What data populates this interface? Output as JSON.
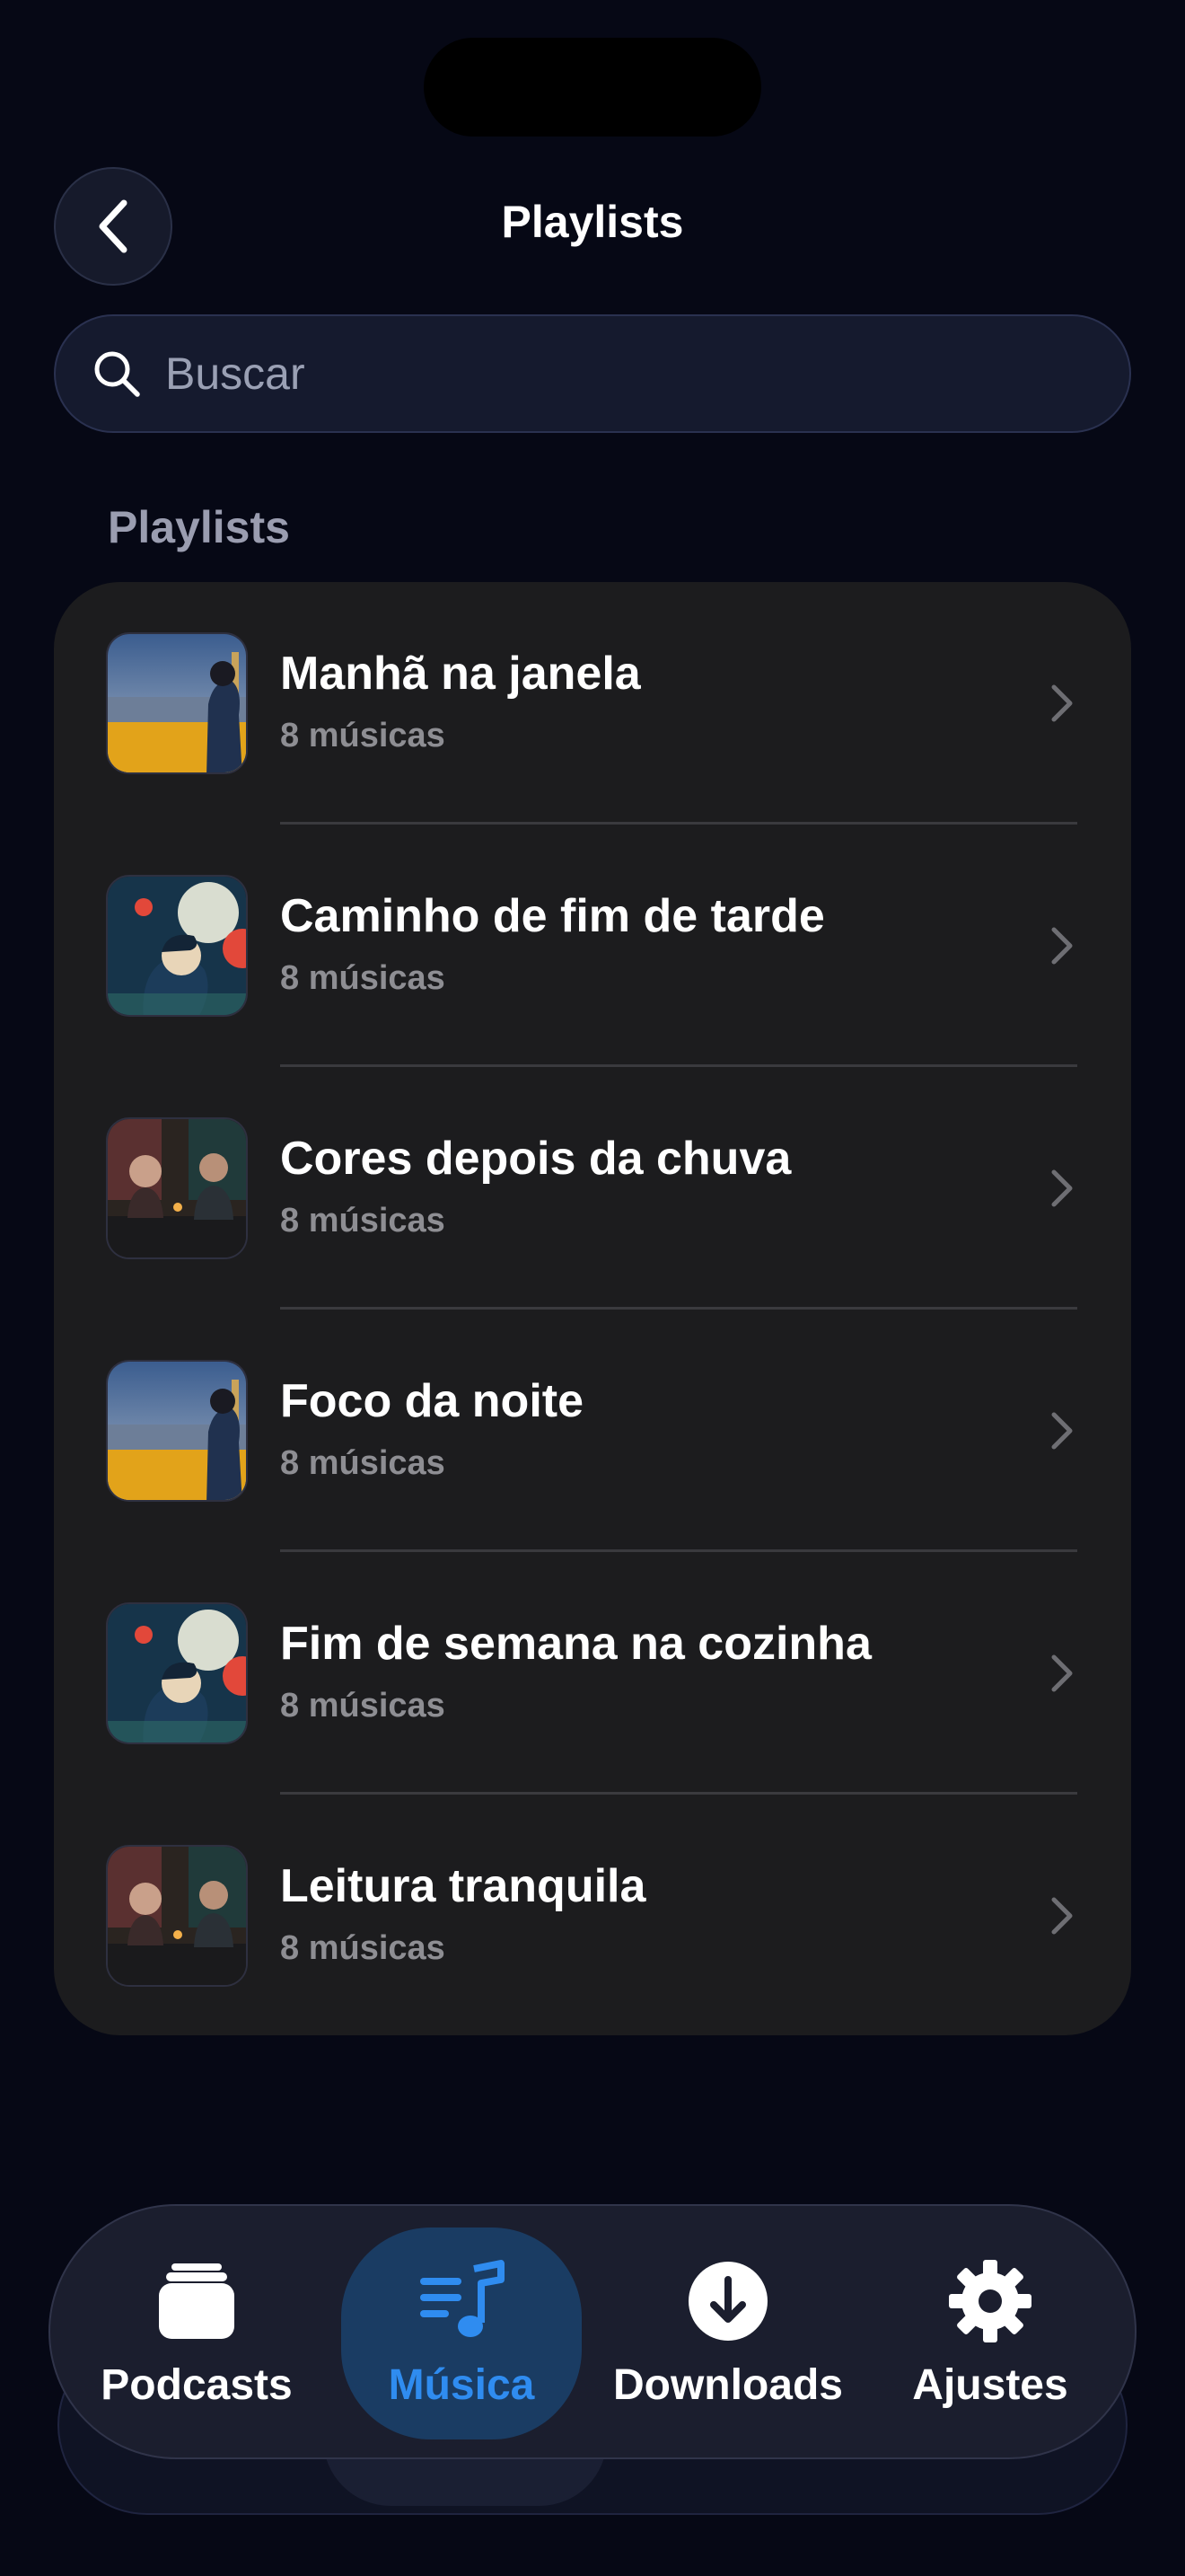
{
  "header": {
    "title": "Playlists",
    "back_icon": "chevron-left-icon"
  },
  "search": {
    "placeholder": "Buscar",
    "value": "",
    "icon": "search-icon"
  },
  "section": {
    "title": "Playlists"
  },
  "playlists": [
    {
      "title": "Manhã na janela",
      "subtitle": "8 músicas",
      "artwork": "man-with-binoculars-city"
    },
    {
      "title": "Caminho de fim de tarde",
      "subtitle": "8 músicas",
      "artwork": "illustrated-portrait-moon"
    },
    {
      "title": "Cores depois da chuva",
      "subtitle": "8 músicas",
      "artwork": "two-people-at-table"
    },
    {
      "title": "Foco da noite",
      "subtitle": "8 músicas",
      "artwork": "man-with-binoculars-city"
    },
    {
      "title": "Fim de semana na cozinha",
      "subtitle": "8 músicas",
      "artwork": "illustrated-portrait-moon"
    },
    {
      "title": "Leitura tranquila",
      "subtitle": "8 músicas",
      "artwork": "two-people-at-table"
    }
  ],
  "tabbar": {
    "tabs": [
      {
        "label": "Podcasts",
        "icon": "stack-icon",
        "active": false
      },
      {
        "label": "Música",
        "icon": "music-list-icon",
        "active": true
      },
      {
        "label": "Downloads",
        "icon": "download-circle-icon",
        "active": false
      },
      {
        "label": "Ajustes",
        "icon": "gear-icon",
        "active": false
      }
    ]
  },
  "colors": {
    "background": "#060815",
    "card": "#1c1c1e",
    "accent": "#2f8cf0",
    "secondary_text": "#8e8e93"
  }
}
